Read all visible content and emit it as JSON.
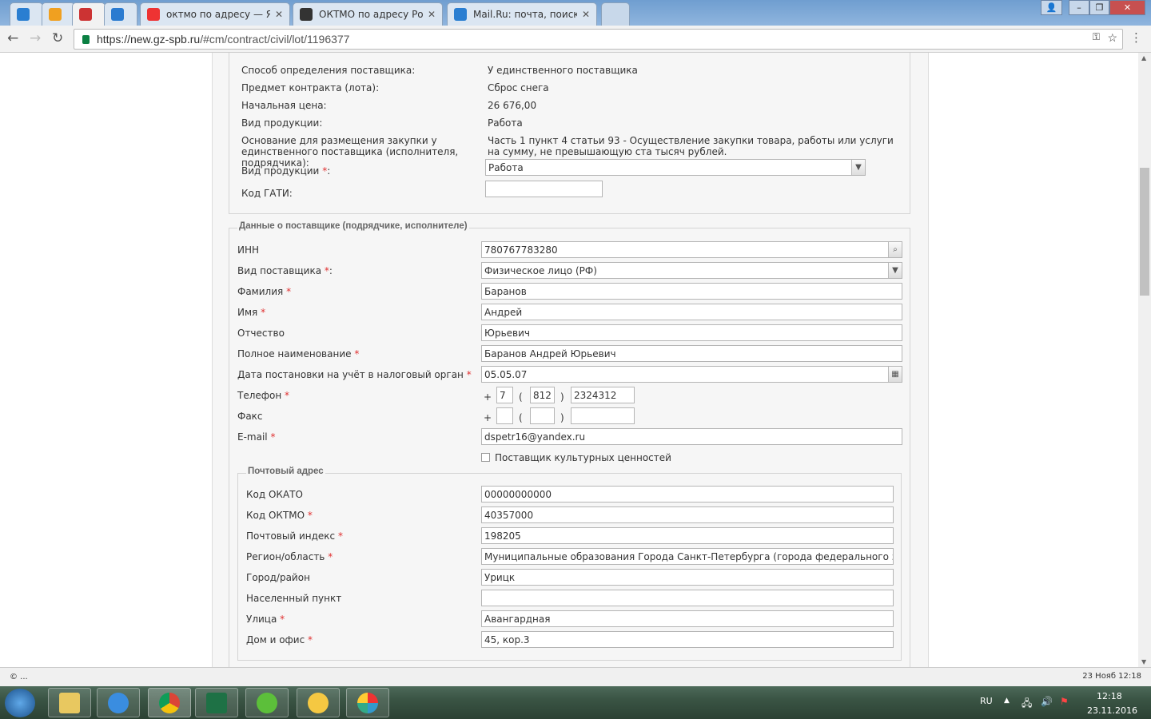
{
  "browser": {
    "tabs": [
      {
        "title": "",
        "icon": "mailru-icon",
        "color": "#2a7ed1"
      },
      {
        "title": "",
        "icon": "mail-envelope-icon",
        "color": "#f0a020"
      },
      {
        "title": "",
        "icon": "tools-icon",
        "color": "#c33"
      },
      {
        "title": "",
        "icon": "help-icon",
        "color": "#2b7bd0"
      },
      {
        "title": "октмо по адресу — Янд",
        "icon": "yandex-icon",
        "color": "#e33"
      },
      {
        "title": "ОКТМО по адресу Росс",
        "icon": "oktmo-icon",
        "color": "#333"
      },
      {
        "title": "Mail.Ru: почта, поиск в",
        "icon": "mailru-icon",
        "color": "#2a7ed1"
      }
    ],
    "url_host": "https://new.gz-spb.ru",
    "url_path": "/#cm/contract/civil/lot/1196377"
  },
  "top_fields": [
    {
      "label": "Способ определения поставщика:",
      "value": "У единственного поставщика"
    },
    {
      "label": "Предмет контракта (лота):",
      "value": "Сброс снега"
    },
    {
      "label": "Начальная цена:",
      "value": "26 676,00"
    },
    {
      "label": "Вид продукции:",
      "value": "Работа"
    },
    {
      "label": "Основание для размещения закупки у единственного поставщика (исполнителя, подрядчика):",
      "value": "Часть 1 пункт 4 статьи 93 - Осуществление закупки товара, работы или услуги на сумму, не превышающую ста тысяч рублей."
    }
  ],
  "product_type": {
    "label": "Вид продукции",
    "value": "Работа"
  },
  "gati": {
    "label": "Код ГАТИ:",
    "value": ""
  },
  "supplier": {
    "legend": "Данные о поставщике (подрядчике, исполнителе)",
    "inn": {
      "label": "ИНН",
      "value": "780767783280"
    },
    "type": {
      "label": "Вид поставщика",
      "value": "Физическое лицо (РФ)"
    },
    "fields": [
      {
        "label": "Фамилия",
        "required": true,
        "value": "Баранов"
      },
      {
        "label": "Имя",
        "required": true,
        "value": "Андрей"
      },
      {
        "label": "Отчество",
        "required": false,
        "value": "Юрьевич"
      },
      {
        "label": "Полное наименование",
        "required": true,
        "value": "Баранов  Андрей Юрьевич"
      }
    ],
    "tax_date": {
      "label": "Дата постановки на учёт в налоговый орган",
      "value": "05.05.07"
    },
    "phone": {
      "label": "Телефон",
      "plus": "+",
      "country": "7",
      "code": "812",
      "number": "2324312"
    },
    "fax": {
      "label": "Факс",
      "plus": "+",
      "country": "",
      "code": "",
      "number": ""
    },
    "email": {
      "label": "E-mail",
      "value": "dspetr16@yandex.ru"
    },
    "cultural": {
      "label": "Поставщик культурных ценностей",
      "checked": false
    }
  },
  "address": {
    "legend": "Почтовый адрес",
    "fields": [
      {
        "label": "Код ОКАТО",
        "required": false,
        "value": "00000000000"
      },
      {
        "label": "Код ОКТМО",
        "required": true,
        "value": "40357000"
      },
      {
        "label": "Почтовый индекс",
        "required": true,
        "value": "198205"
      },
      {
        "label": "Регион/область",
        "required": true,
        "value": "Муниципальные образования Города Санкт-Петербурга (города федерального значения)"
      },
      {
        "label": "Город/район",
        "required": false,
        "value": "Урицк"
      },
      {
        "label": "Населенный пункт",
        "required": false,
        "value": ""
      },
      {
        "label": "Улица",
        "required": true,
        "value": "Авангардная"
      },
      {
        "label": "Дом и офис",
        "required": true,
        "value": "45, кор.3"
      }
    ]
  },
  "status_bar": {
    "left": "© ...",
    "right": "23 Нояб 12:18"
  },
  "taskbar": {
    "lang": "RU",
    "time": "12:18",
    "date": "23.11.2016"
  },
  "req_mark": "*"
}
